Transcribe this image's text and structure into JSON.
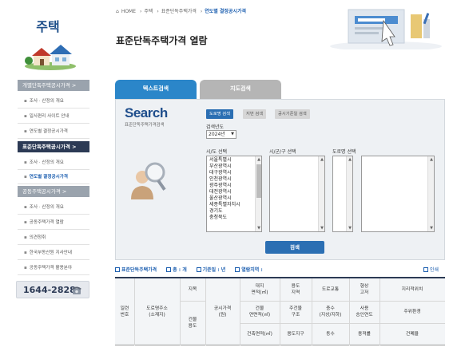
{
  "sidebar": {
    "title": "주택",
    "sections": [
      {
        "label": "개별단독주택공시가격 >",
        "style": "gray",
        "items": [
          "조사 · 산정의 개요",
          "일사편리 사이트 안내",
          "연도별 결정공시가격"
        ]
      },
      {
        "label": "표준단독주택공시가격 >",
        "style": "navy",
        "items": [
          "조사 · 산정의 개요",
          "연도별 결정공시가격"
        ]
      },
      {
        "label": "공동주택공시가격 >",
        "style": "gray",
        "items": [
          "조사 · 산정의 개요",
          "공동주택가격 열람",
          "의견청취",
          "한국부동산원 지사안내",
          "공동주택가격 활용분야"
        ]
      }
    ],
    "phone": "1644-2828"
  },
  "breadcrumb": [
    "HOME",
    "주택",
    "표준단독주택가격",
    "연도별 결정공시가격"
  ],
  "page_title": "표준단독주택가격 열람",
  "tabs": {
    "text": "텍스트검색",
    "map": "지도검색"
  },
  "search": {
    "logo": "Search",
    "subtitle": "표준단독주택가격검색",
    "mode_buttons": [
      "도로명 검색",
      "지번 검색",
      "공시기준일 검색"
    ],
    "year_label": "검색년도",
    "year_value": "2024년",
    "sido_label": "시/도 선택",
    "sigungu_label": "시/군/구 선택",
    "road_label": "도로명 선택",
    "sido_options": [
      "서울특별시",
      "부산광역시",
      "대구광역시",
      "인천광역시",
      "광주광역시",
      "대전광역시",
      "울산광역시",
      "세종특별자치시",
      "경기도",
      "충청북도"
    ],
    "search_button": "검색"
  },
  "info_bar": {
    "title": "표준단독주택가격",
    "total": "총 : 개",
    "base_year": "기준일 : 년",
    "area": "열람지역 :",
    "print": "인쇄"
  },
  "table": {
    "col_serial": "일련\n번호",
    "col_address": "도로명주소\n(소재지)",
    "col_jimok": "지목",
    "col_price": "공시가격\n(원)",
    "col_land_area": "대지\n면적(㎡)",
    "col_zone": "용도\n지역",
    "col_road": "도로교통",
    "col_shape": "형상\n고저",
    "col_geo": "지리적위치",
    "col_bldg_use": "건물\n용도",
    "col_bldg_area": "건물\n연면적(㎡)",
    "col_struct": "주건물\n구조",
    "col_floors": "층수\n(지상/지하)",
    "col_approval": "사용\n승인연도",
    "col_env": "주위환경",
    "col_build_area": "건축면적(㎡)",
    "col_district": "용도지구",
    "col_units": "동수",
    "col_ratio": "용적률",
    "col_coverage": "건폐율"
  },
  "colors": {
    "navy": "#2c3a55",
    "accent_blue": "#2b6fb3",
    "tab_blue": "#2b86c9"
  }
}
